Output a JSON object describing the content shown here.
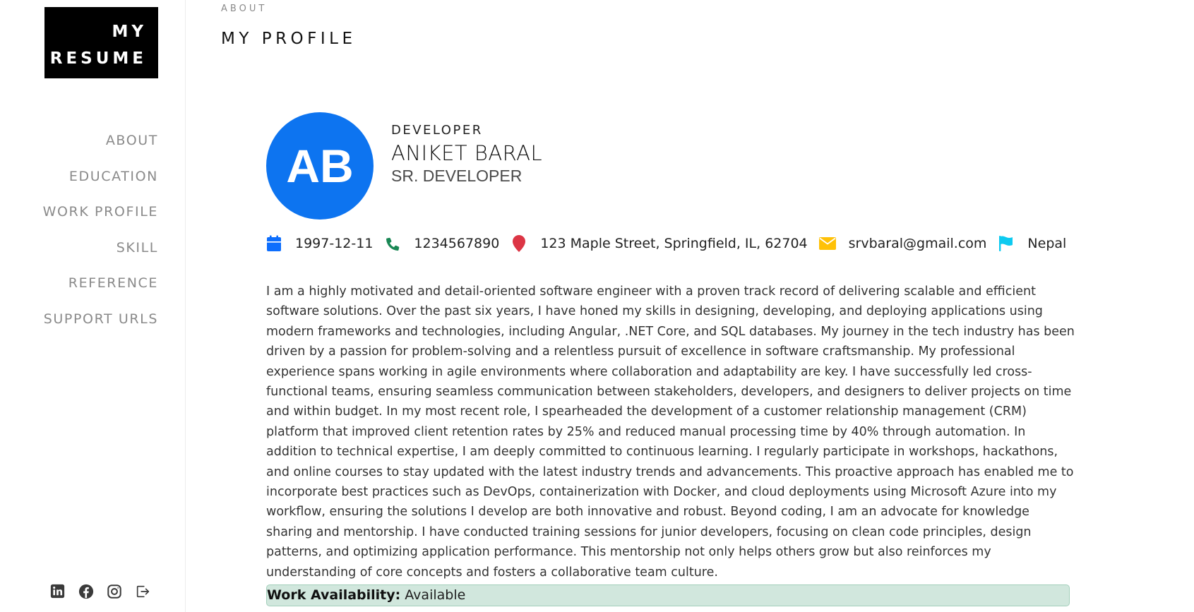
{
  "brand": {
    "line1": "MY",
    "line2": "RESUME"
  },
  "nav": {
    "items": [
      {
        "label": "ABOUT"
      },
      {
        "label": "EDUCATION"
      },
      {
        "label": "WORK PROFILE"
      },
      {
        "label": "SKILL"
      },
      {
        "label": "REFERENCE"
      },
      {
        "label": "SUPPORT URLS"
      }
    ]
  },
  "social": [
    "linkedin-icon",
    "facebook-icon",
    "instagram-icon",
    "logout-icon"
  ],
  "section": {
    "kicker": "ABOUT",
    "title": "MY PROFILE"
  },
  "profile": {
    "initials": "AB",
    "role_kicker": "DEVELOPER",
    "name": "ANIKET BARAL",
    "subtitle": "SR. DEVELOPER",
    "avatar_color": "#0d74f0"
  },
  "contacts": {
    "dob": "1997-12-11",
    "phone": "1234567890",
    "address": "123 Maple Street, Springfield, IL, 62704",
    "email": "srvbaral@gmail.com",
    "country": "Nepal"
  },
  "bio": "I am a highly motivated and detail-oriented software engineer with a proven track record of delivering scalable and efficient software solutions. Over the past six years, I have honed my skills in designing, developing, and deploying applications using modern frameworks and technologies, including Angular, .NET Core, and SQL databases. My journey in the tech industry has been driven by a passion for problem-solving and a relentless pursuit of excellence in software craftsmanship. My professional experience spans working in agile environments where collaboration and adaptability are key. I have successfully led cross-functional teams, ensuring seamless communication between stakeholders, developers, and designers to deliver projects on time and within budget. In my most recent role, I spearheaded the development of a customer relationship management (CRM) platform that improved client retention rates by 25% and reduced manual processing time by 40% through automation. In addition to technical expertise, I am deeply committed to continuous learning. I regularly participate in workshops, hackathons, and online courses to stay updated with the latest industry trends and advancements. This proactive approach has enabled me to incorporate best practices such as DevOps, containerization with Docker, and cloud deployments using Microsoft Azure into my workflow, ensuring the solutions I develop are both innovative and robust. Beyond coding, I am an advocate for knowledge sharing and mentorship. I have conducted training sessions for junior developers, focusing on clean code principles, design patterns, and optimizing application performance. This mentorship not only helps others grow but also reinforces my understanding of core concepts and fosters a collaborative team culture.",
  "availability": {
    "label": "Work Availability:",
    "value": "Available"
  },
  "colors": {
    "calendar": "#0d6efd",
    "phone": "#198754",
    "location": "#dc3545",
    "email": "#ffc107",
    "flag": "#0dcaf0",
    "availability_bg": "#d1e7dd"
  }
}
